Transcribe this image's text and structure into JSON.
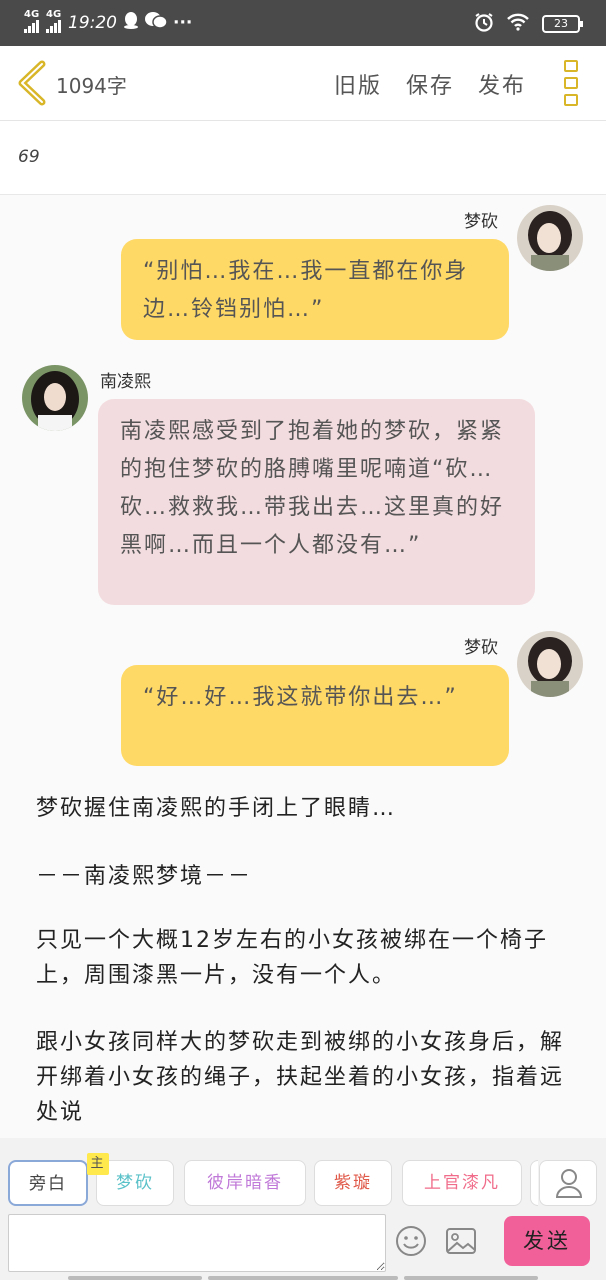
{
  "status_bar": {
    "network_1": "4G",
    "network_2": "4G",
    "time": "19:20",
    "more": "···",
    "battery": "23",
    "icons": [
      "qq-icon",
      "wechat-icon",
      "alarm-icon",
      "wifi-icon",
      "battery-icon"
    ]
  },
  "toolbar": {
    "word_count": "1094字",
    "old_version": "旧版",
    "save": "保存",
    "publish": "发布"
  },
  "title": "69",
  "messages": [
    {
      "side": "right",
      "name": "梦砍",
      "text": "“别怕…我在…我一直都在你身边…铃铛别怕…”",
      "color": "#ffd966"
    },
    {
      "side": "left",
      "name": "南凌熙",
      "text": "南凌熙感受到了抱着她的梦砍，紧紧的抱住梦砍的胳膊嘴里呢喃道“砍…砍…救救我…带我出去…这里真的好黑啊…而且一个人都没有…”",
      "color": "#f3dcdf"
    },
    {
      "side": "right",
      "name": "梦砍",
      "text": "“好…好…我这就带你出去…”",
      "color": "#ffd966"
    }
  ],
  "narration": [
    "梦砍握住南凌熙的手闭上了眼睛…",
    "－－南凌熙梦境－－",
    "只见一个大概12岁左右的小女孩被绑在一个椅子上，周围漆黑一片，没有一个人。",
    "跟小女孩同样大的梦砍走到被绑的小女孩身后，解开绑着小女孩的绳子，扶起坐着的小女孩，指着远处说"
  ],
  "roles": {
    "narrator": "旁白",
    "role_1": "梦砍",
    "role_1_badge": "主",
    "role_2": "彼岸暗香",
    "role_3": "紫璇",
    "role_4": "上官漆凡"
  },
  "input": {
    "value": "",
    "placeholder": "",
    "send": "发送"
  }
}
